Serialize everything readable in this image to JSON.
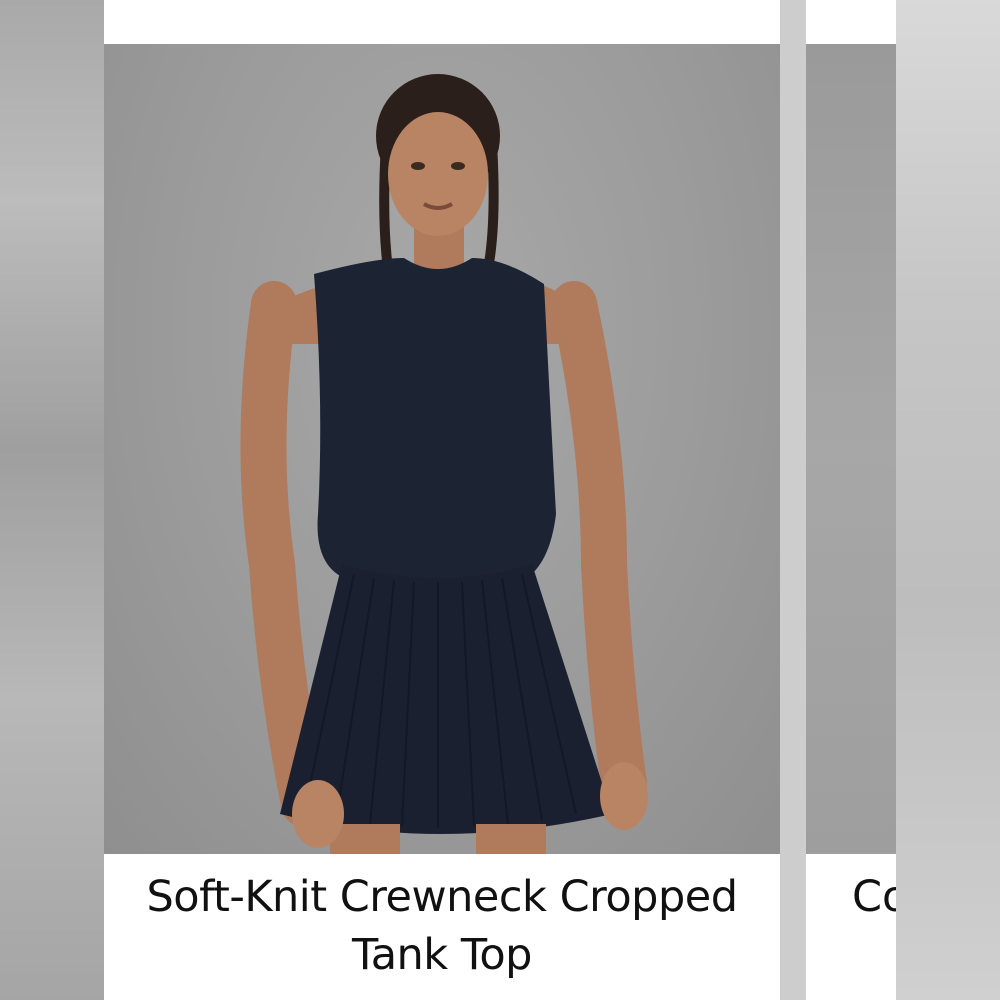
{
  "product": {
    "title": "Soft-Knit Crewneck Cropped Tank Top",
    "image_alt": "Model wearing a navy sleeveless cropped tank top with a navy pleated skirt"
  },
  "next_product": {
    "title_partial": "Co"
  },
  "colors": {
    "garment": "#1c2433",
    "backdrop": "#9b9b9b",
    "card": "#ffffff",
    "text": "#111111"
  }
}
